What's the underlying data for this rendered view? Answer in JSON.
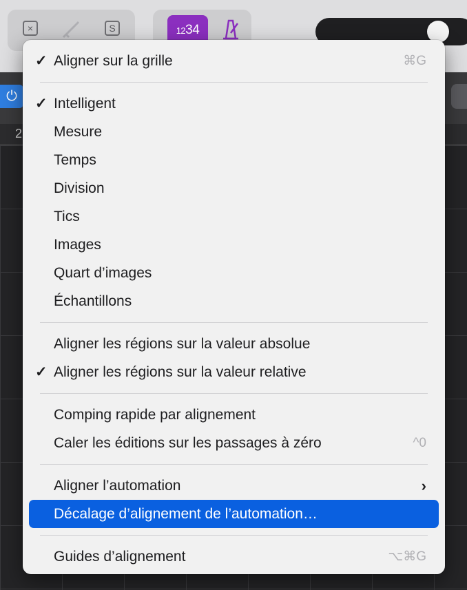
{
  "toolbar": {
    "lcd_left": "12",
    "lcd_right": "34",
    "ruler_number": "2"
  },
  "menu": {
    "items": [
      {
        "label": "Aligner sur la grille",
        "checked": true,
        "shortcut": "⌘G"
      },
      {
        "label": "Intelligent",
        "checked": true
      },
      {
        "label": "Mesure"
      },
      {
        "label": "Temps"
      },
      {
        "label": "Division"
      },
      {
        "label": "Tics"
      },
      {
        "label": "Images"
      },
      {
        "label": "Quart d’images"
      },
      {
        "label": "Échantillons"
      },
      {
        "label": "Aligner les régions sur la valeur absolue"
      },
      {
        "label": "Aligner les régions sur la valeur relative",
        "checked": true
      },
      {
        "label": "Comping rapide par alignement"
      },
      {
        "label": "Caler les éditions sur les passages à zéro",
        "shortcut": "^0"
      },
      {
        "label": "Aligner l’automation",
        "submenu": true
      },
      {
        "label": "Décalage d’alignement de l’automation…",
        "highlighted": true
      },
      {
        "label": "Guides d’alignement",
        "shortcut": "⌥⌘G"
      }
    ],
    "check_glyph": "✓",
    "submenu_glyph": "›"
  },
  "colors": {
    "highlight": "#0a60e0",
    "lcd": "#8b2fbf",
    "power": "#2f7ee0"
  }
}
